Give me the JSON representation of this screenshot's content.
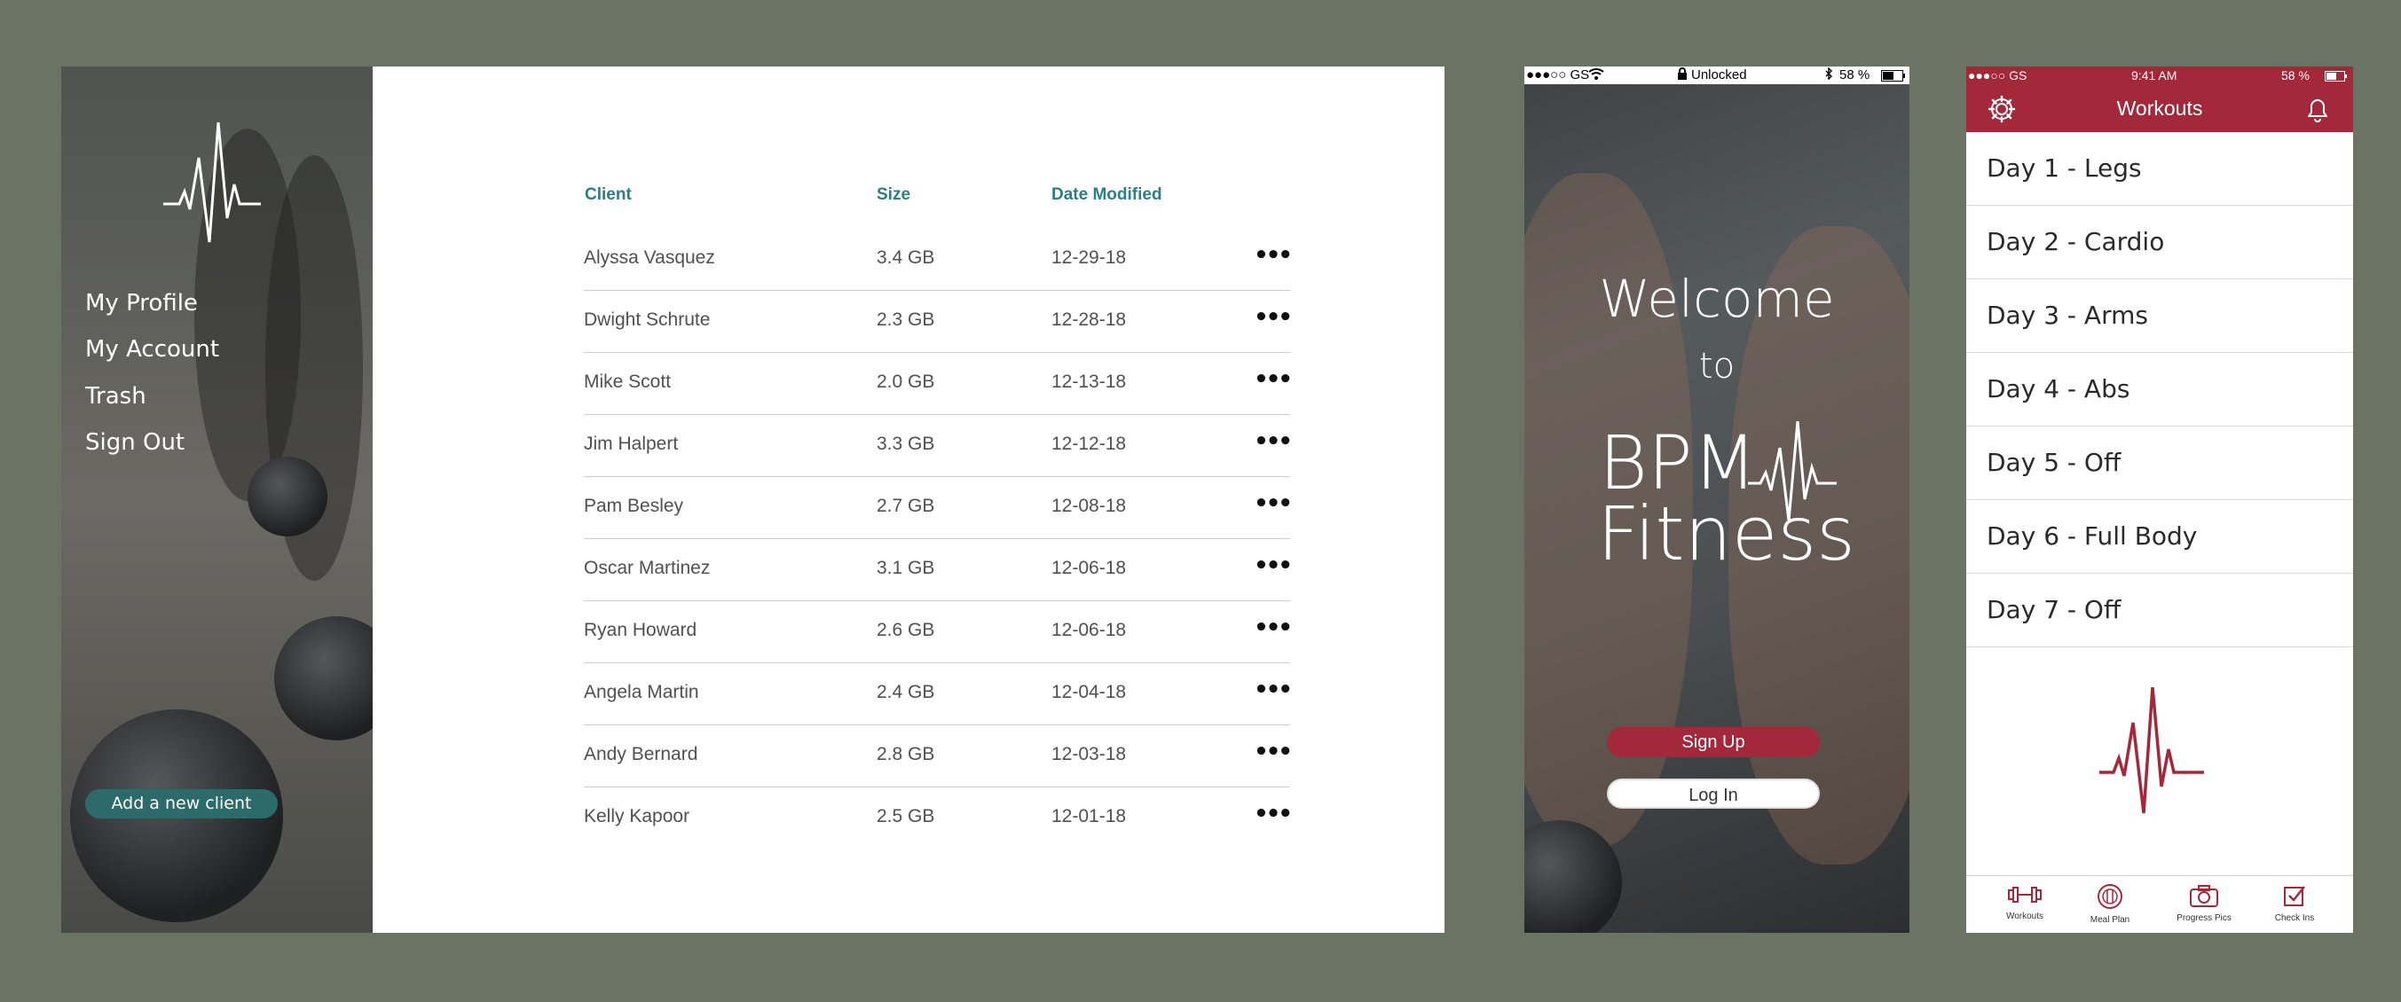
{
  "colors": {
    "background": "#6a7364",
    "teal": "#2b7e84",
    "brand_red": "#a3293a"
  },
  "dashboard": {
    "nav": [
      "My Profile",
      "My Account",
      "Trash",
      "Sign Out"
    ],
    "add_client_label": "Add a new client",
    "columns": [
      "Client",
      "Size",
      "Date Modified"
    ],
    "rows": [
      {
        "client": "Alyssa Vasquez",
        "size": "3.4 GB",
        "date": "12-29-18"
      },
      {
        "client": "Dwight Schrute",
        "size": "2.3 GB",
        "date": "12-28-18"
      },
      {
        "client": "Mike Scott",
        "size": "2.0 GB",
        "date": "12-13-18"
      },
      {
        "client": "Jim Halpert",
        "size": "3.3 GB",
        "date": "12-12-18"
      },
      {
        "client": "Pam Besley",
        "size": "2.7 GB",
        "date": "12-08-18"
      },
      {
        "client": "Oscar Martinez",
        "size": "3.1 GB",
        "date": "12-06-18"
      },
      {
        "client": "Ryan Howard",
        "size": "2.6 GB",
        "date": "12-06-18"
      },
      {
        "client": "Angela Martin",
        "size": "2.4 GB",
        "date": "12-04-18"
      },
      {
        "client": "Andy Bernard",
        "size": "2.8 GB",
        "date": "12-03-18"
      },
      {
        "client": "Kelly Kapoor",
        "size": "2.5 GB",
        "date": "12-01-18"
      }
    ],
    "more_label": "•••"
  },
  "welcome": {
    "status": {
      "carrier": "●●●○○ GS",
      "center": "Unlocked",
      "battery": "58 %"
    },
    "line1": "Welcome",
    "line2": "to",
    "brand1": "BPM",
    "brand2": "Fitness",
    "signup_label": "Sign Up",
    "login_label": "Log In"
  },
  "workouts": {
    "status": {
      "carrier": "●●●○○ GS",
      "time": "9:41 AM",
      "battery": "58 %"
    },
    "title": "Workouts",
    "days": [
      "Day 1 - Legs",
      "Day 2 - Cardio",
      "Day 3 - Arms",
      "Day 4 - Abs",
      "Day 5 - Off",
      "Day 6 - Full Body",
      "Day 7 - Off"
    ],
    "tabs": [
      "Workouts",
      "Meal Plan",
      "Progress Pics",
      "Check Ins"
    ]
  }
}
